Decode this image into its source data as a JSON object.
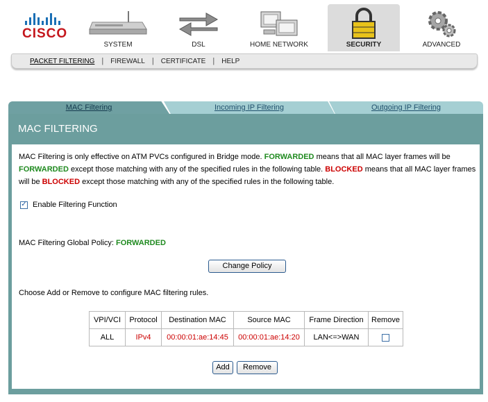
{
  "brand": {
    "logo_text": "CISCO"
  },
  "nav": {
    "items": [
      {
        "label": "SYSTEM",
        "icon": "modem-icon"
      },
      {
        "label": "DSL",
        "icon": "arrows-exchange-icon"
      },
      {
        "label": "HOME NETWORK",
        "icon": "computers-icon"
      },
      {
        "label": "SECURITY",
        "icon": "padlock-icon",
        "active": true
      },
      {
        "label": "ADVANCED",
        "icon": "gears-icon"
      }
    ]
  },
  "subnav": {
    "items": [
      "PACKET FILTERING",
      "FIREWALL",
      "CERTIFICATE",
      "HELP"
    ],
    "active": "PACKET FILTERING"
  },
  "tabs": [
    "MAC Filtering",
    "Incoming IP Filtering",
    "Outgoing IP Filtering"
  ],
  "panel": {
    "title": "MAC FILTERING",
    "desc": {
      "p1": "MAC Filtering is only effective on ATM PVCs configured in Bridge mode. ",
      "fw1": "FORWARDED",
      "p2": " means that all MAC layer frames will be ",
      "fw2": "FORWARDED",
      "p3": " except those matching with any of the specified rules in the following table. ",
      "bl1": "BLOCKED",
      "p4": " means that all MAC layer frames will be ",
      "bl2": "BLOCKED",
      "p5": " except those matching with any of the specified rules in the following table."
    },
    "enable_label": "Enable Filtering Function",
    "enable_checked": true,
    "policy_label": "MAC Filtering Global Policy: ",
    "policy_value": "FORWARDED",
    "change_policy_button": "Change Policy",
    "choose_text": "Choose Add or Remove to configure MAC filtering rules.",
    "table": {
      "headers": [
        "VPI/VCI",
        "Protocol",
        "Destination MAC",
        "Source MAC",
        "Frame Direction",
        "Remove"
      ],
      "rows": [
        {
          "vpi_vci": "ALL",
          "protocol": "IPv4",
          "dest_mac": "00:00:01:ae:14:45",
          "src_mac": "00:00:01:ae:14:20",
          "direction": "LAN<=>WAN"
        }
      ]
    },
    "add_button": "Add",
    "remove_button": "Remove"
  },
  "colors": {
    "panel_teal": "#6c9e9e",
    "forwarded_green": "#1f8a1f",
    "blocked_red": "#cc0000",
    "cisco_red": "#c4161c",
    "cisco_blue": "#1a6fb5"
  }
}
